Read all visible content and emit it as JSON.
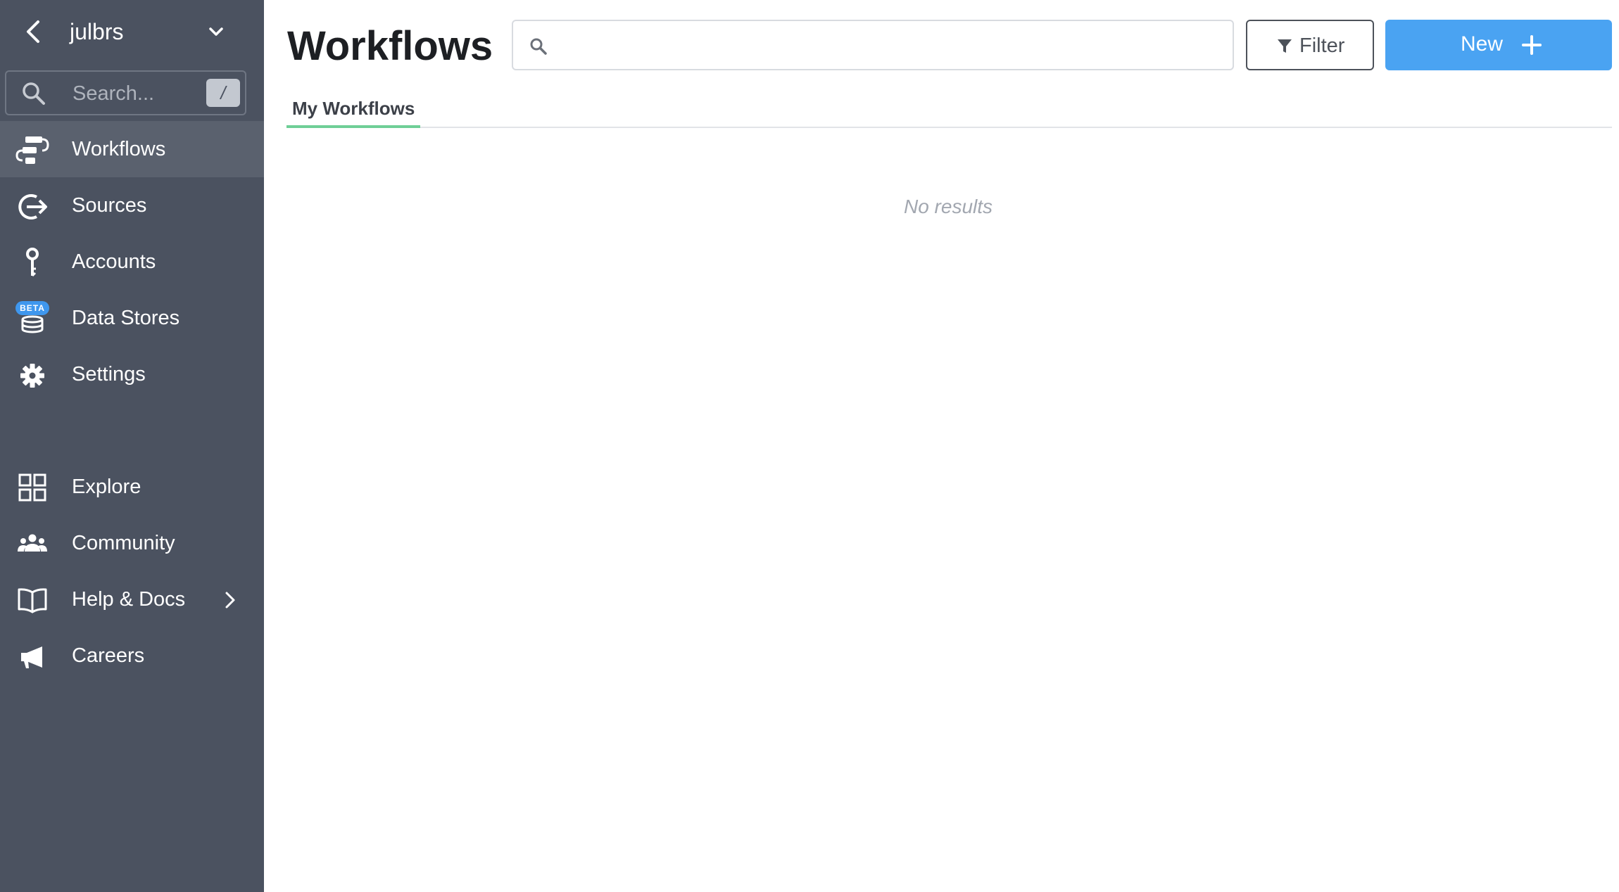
{
  "sidebar": {
    "org_name": "julbrs",
    "search": {
      "placeholder": "Search...",
      "shortcut": "/"
    },
    "nav": [
      {
        "label": "Workflows",
        "icon": "workflows-icon",
        "active": true
      },
      {
        "label": "Sources",
        "icon": "sources-icon"
      },
      {
        "label": "Accounts",
        "icon": "key-icon"
      },
      {
        "label": "Data Stores",
        "icon": "database-icon",
        "badge": "BETA"
      },
      {
        "label": "Settings",
        "icon": "gear-icon"
      }
    ],
    "secondary_nav": [
      {
        "label": "Explore",
        "icon": "grid-icon"
      },
      {
        "label": "Community",
        "icon": "people-icon"
      },
      {
        "label": "Help & Docs",
        "icon": "book-icon"
      },
      {
        "label": "Careers",
        "icon": "megaphone-icon"
      }
    ]
  },
  "main": {
    "title": "Workflows",
    "search": {
      "value": "",
      "placeholder": ""
    },
    "filter_label": "Filter",
    "new_label": "New",
    "tabs": [
      {
        "label": "My Workflows",
        "active": true
      }
    ],
    "empty_message": "No results"
  },
  "colors": {
    "sidebar_bg": "#4b5260",
    "sidebar_active": "#5a616e",
    "primary_button": "#4aa3f2",
    "tab_underline": "#6fcf97",
    "beta_badge": "#3f97ee"
  }
}
